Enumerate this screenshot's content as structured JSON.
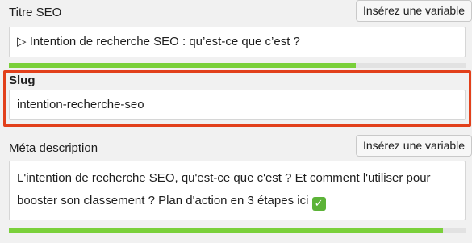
{
  "seo_title": {
    "label": "Titre SEO",
    "insert_variable_label": "Insérez une variable",
    "value": "▷ Intention de recherche SEO : qu’est-ce que c’est ?",
    "progress_percent": 76
  },
  "slug": {
    "label": "Slug",
    "value": "intention-recherche-seo"
  },
  "meta_description": {
    "label": "Méta description",
    "insert_variable_label": "Insérez une variable",
    "value_line1": "L'intention de recherche SEO, qu'est-ce que c'est ? Et comment l'utiliser pour",
    "value_line2": "booster son classement ? Plan d'action en 3 étapes ici",
    "progress_percent": 95
  },
  "colors": {
    "progress_good": "#7ad03a",
    "highlight_border": "#e2401b"
  },
  "icons": {
    "check_emoji": "white-check-mark-icon"
  }
}
